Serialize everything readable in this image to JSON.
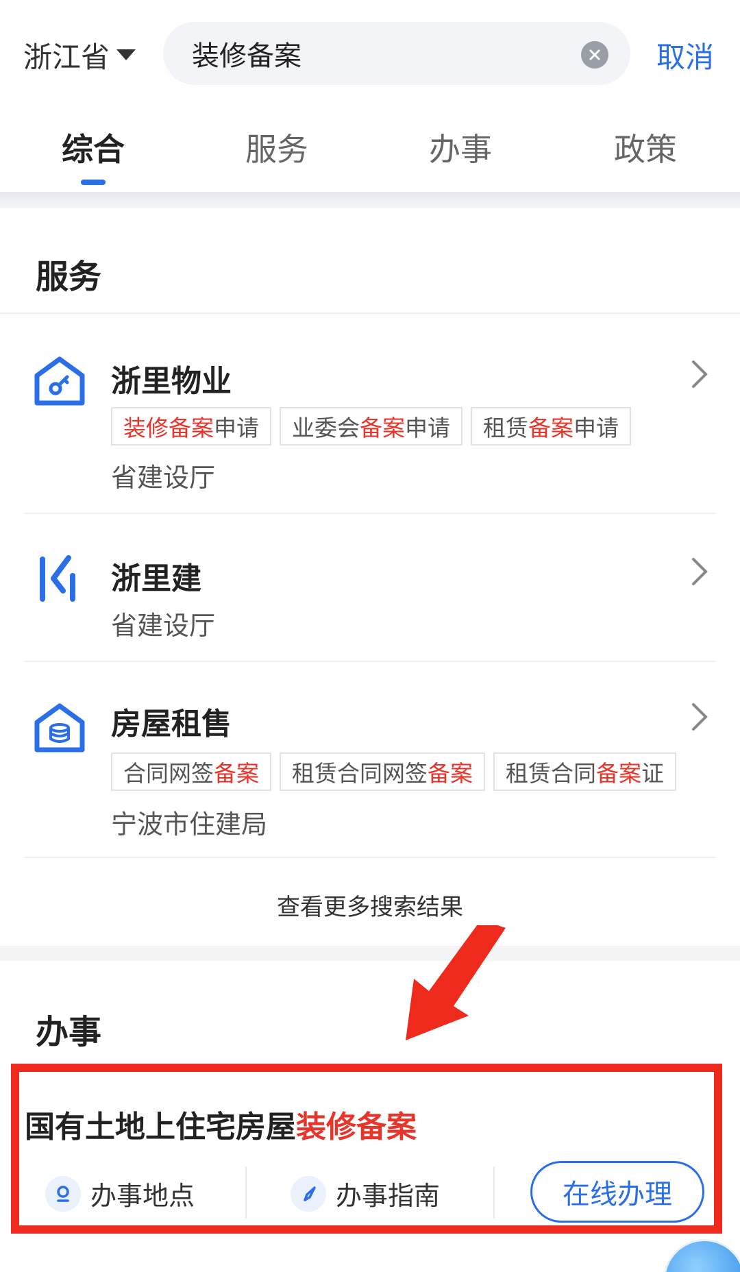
{
  "header": {
    "region": "浙江省",
    "search_value": "装修备案",
    "cancel_label": "取消"
  },
  "tabs": [
    {
      "label": "综合",
      "active": true
    },
    {
      "label": "服务",
      "active": false
    },
    {
      "label": "办事",
      "active": false
    },
    {
      "label": "政策",
      "active": false
    }
  ],
  "services": {
    "title": "服务",
    "items": [
      {
        "name": "浙里物业",
        "icon": "house-key-icon",
        "tags": [
          {
            "parts": [
              {
                "text": "装修备案",
                "highlight": true
              },
              {
                "text": "申请",
                "highlight": false
              }
            ]
          },
          {
            "parts": [
              {
                "text": "业委会",
                "highlight": false
              },
              {
                "text": "备案",
                "highlight": true
              },
              {
                "text": "申请",
                "highlight": false
              }
            ]
          },
          {
            "parts": [
              {
                "text": "租赁",
                "highlight": false
              },
              {
                "text": "备案",
                "highlight": true
              },
              {
                "text": "申请",
                "highlight": false
              }
            ]
          }
        ],
        "org": "省建设厅"
      },
      {
        "name": "浙里建",
        "icon": "zlj-logo-icon",
        "tags": [],
        "org": "省建设厅"
      },
      {
        "name": "房屋租售",
        "icon": "house-coin-icon",
        "tags": [
          {
            "parts": [
              {
                "text": "合同网签",
                "highlight": false
              },
              {
                "text": "备案",
                "highlight": true
              }
            ]
          },
          {
            "parts": [
              {
                "text": "租赁合同网签",
                "highlight": false
              },
              {
                "text": "备案",
                "highlight": true
              }
            ]
          },
          {
            "parts": [
              {
                "text": "租赁合同",
                "highlight": false
              },
              {
                "text": "备案",
                "highlight": true
              },
              {
                "text": "证",
                "highlight": false
              }
            ]
          }
        ],
        "org": "宁波市住建局"
      }
    ],
    "more_label": "查看更多搜索结果"
  },
  "affairs": {
    "title": "办事",
    "item": {
      "title_plain": "国有土地上住宅房屋",
      "title_highlight": "装修备案",
      "location_label": "办事地点",
      "guide_label": "办事指南",
      "online_label": "在线办理"
    }
  },
  "colors": {
    "accent": "#2a6ee8",
    "highlight": "#e8352c",
    "annotation": "#ee2a1c"
  }
}
